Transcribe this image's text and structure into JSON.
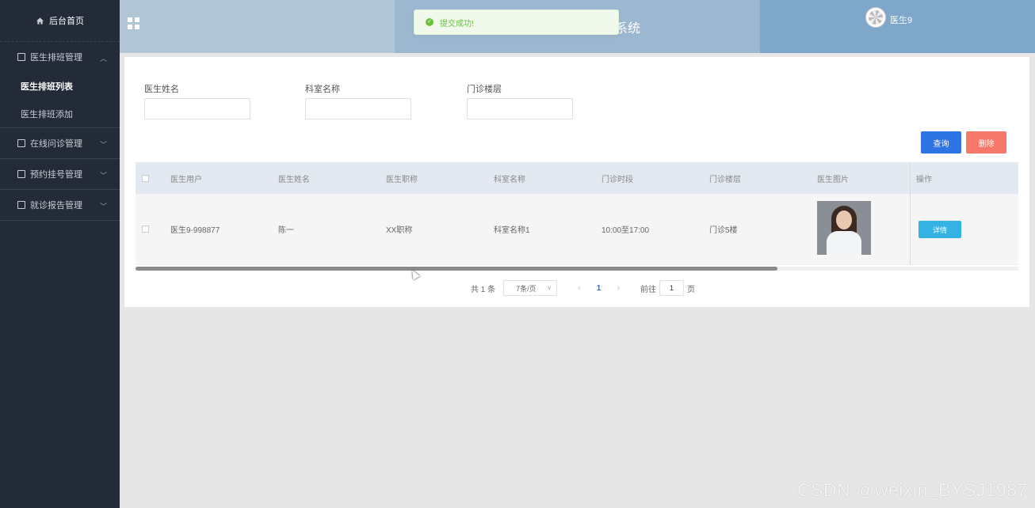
{
  "sidebar": {
    "home_label": "后台首页",
    "groups": [
      {
        "label": "医生排班管理",
        "items": [
          {
            "label": "医生排班列表"
          },
          {
            "label": "医生排班添加"
          }
        ]
      },
      {
        "label": "在线问诊管理"
      },
      {
        "label": "预约挂号管理"
      },
      {
        "label": "就诊报告管理"
      }
    ]
  },
  "header": {
    "title_fragment": "系统",
    "username": "医生9"
  },
  "toast": {
    "message": "提交成功!"
  },
  "search": {
    "fields": [
      {
        "label": "医生姓名",
        "value": ""
      },
      {
        "label": "科室名称",
        "value": ""
      },
      {
        "label": "门诊楼层",
        "value": ""
      }
    ],
    "query_label": "查询",
    "delete_label": "删除"
  },
  "table": {
    "columns": [
      "医生用户",
      "医生姓名",
      "医生职称",
      "科室名称",
      "门诊时段",
      "门诊楼层",
      "医生图片",
      "操作"
    ],
    "rows": [
      {
        "user": "医生9-998877",
        "name": "陈一",
        "title": "XX职称",
        "dept": "科室名称1",
        "time": "10:00至17:00",
        "floor": "门诊5楼",
        "action": "详情"
      }
    ]
  },
  "pagination": {
    "total_text": "共 1 条",
    "page_size": "7条/页",
    "current_page": "1",
    "goto_label": "前往",
    "goto_value": "1",
    "page_suffix": "页"
  },
  "watermark": "CSDN @weixin_BYSJ1987",
  "colors": {
    "sidebar": "#232a38",
    "primary": "#2f74e4",
    "danger": "#f6786b",
    "info": "#34b2e4",
    "success": "#67c23a"
  }
}
